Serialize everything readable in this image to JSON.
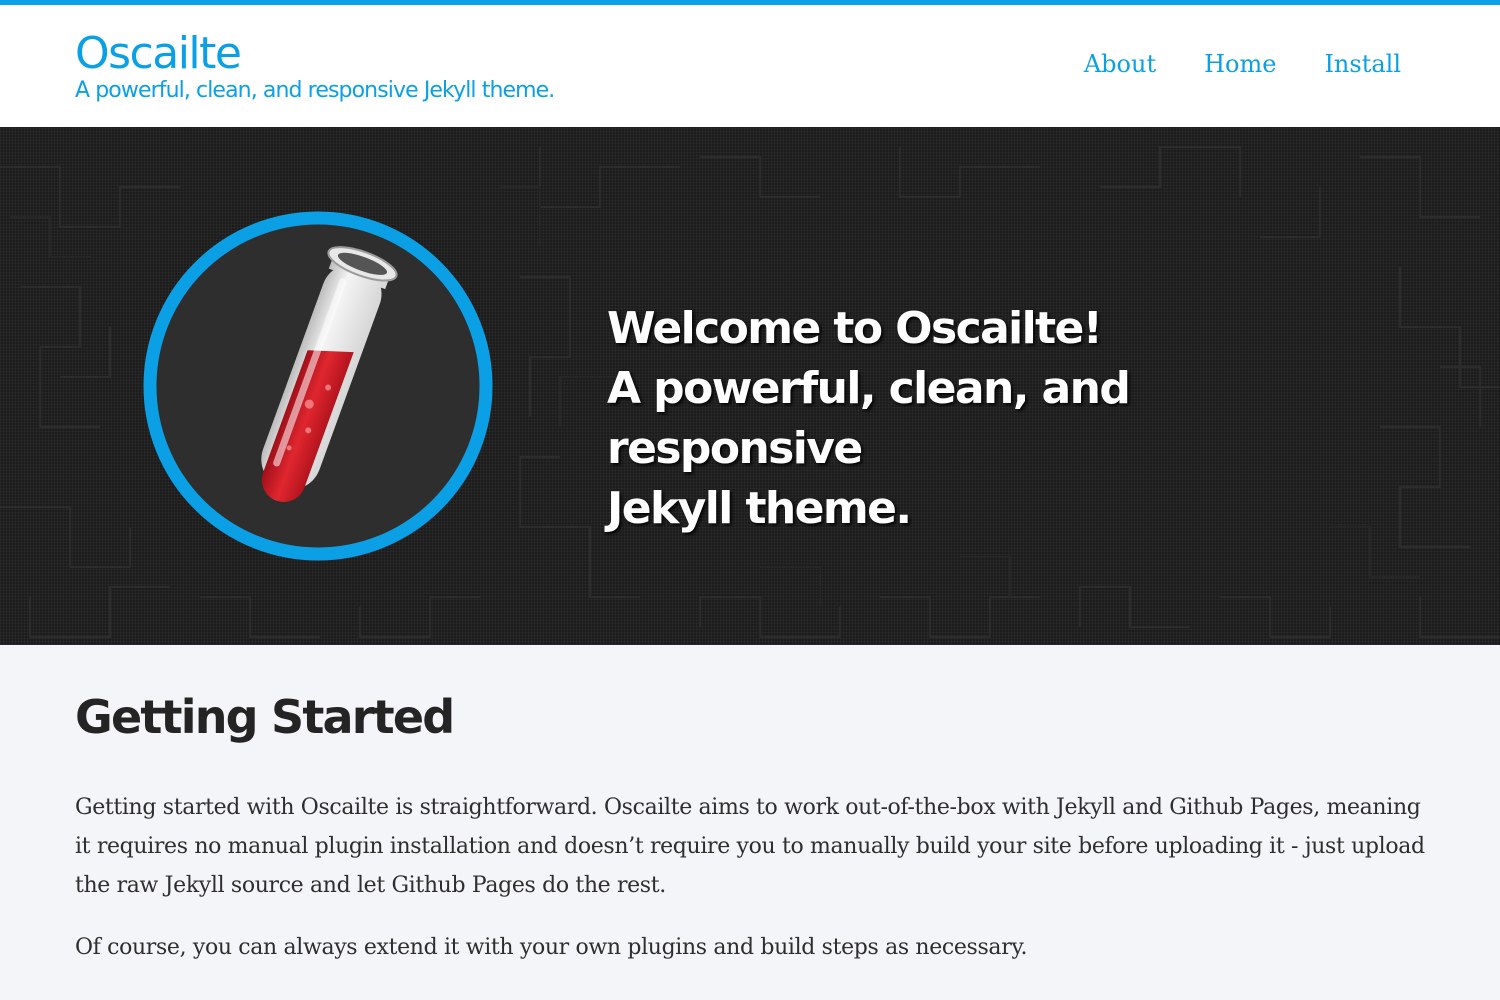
{
  "header": {
    "site_title": "Oscailte",
    "tagline": "A powerful, clean, and responsive Jekyll theme.",
    "nav": [
      {
        "label": "About"
      },
      {
        "label": "Home"
      },
      {
        "label": "Install"
      }
    ]
  },
  "hero": {
    "line_1": "Welcome to Oscailte!",
    "line_2": "A powerful, clean, and responsive",
    "line_3": "Jekyll theme.",
    "logo_icon": "test-tube-icon"
  },
  "main": {
    "heading": "Getting Started",
    "paragraphs": [
      "Getting started with Oscailte is straightforward. Oscailte aims to work out-of-the-box with Jekyll and Github Pages, meaning it requires no manual plugin installation and doesn’t require you to manually build your site before uploading it - just upload the raw Jekyll source and let Github Pages do the rest.",
      "Of course, you can always extend it with your own plugins and build steps as necessary."
    ]
  },
  "colors": {
    "accent": "#0ba0e6",
    "hero_background": "#1c1c1c",
    "content_background": "#f4f5f8",
    "liquid": "#d41f2b"
  }
}
